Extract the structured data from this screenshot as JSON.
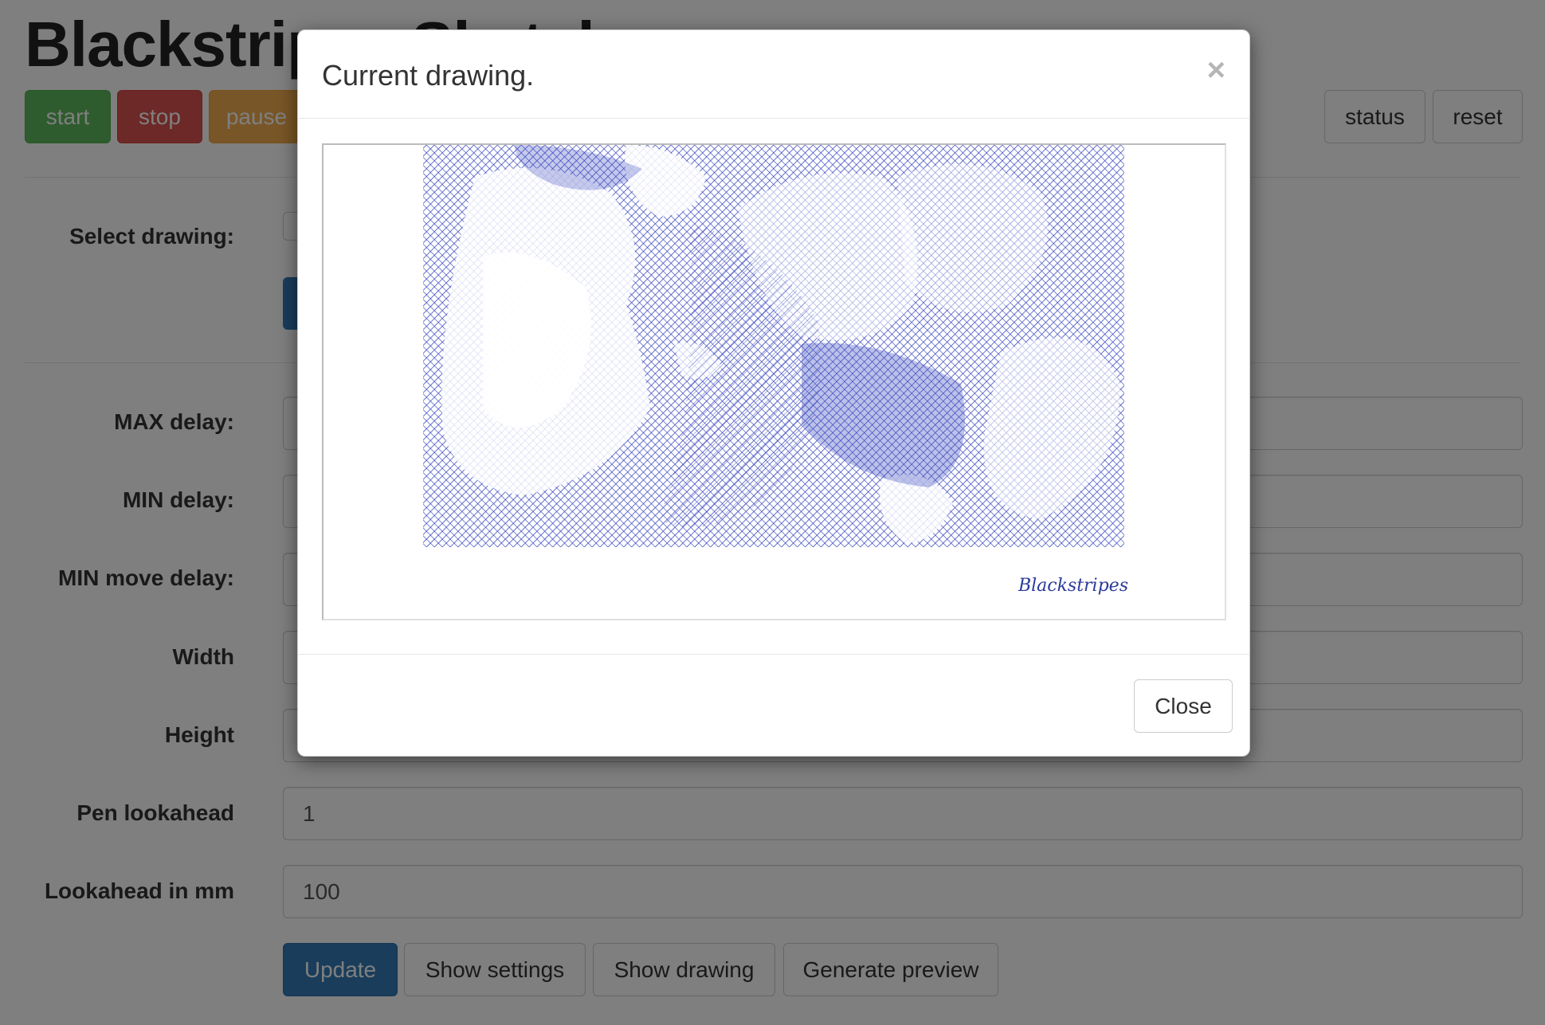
{
  "app": {
    "title": "Blackstripes Sketch"
  },
  "toolbar": {
    "start_label": "start",
    "stop_label": "stop",
    "pause_label": "pause",
    "status_label": "status",
    "reset_label": "reset"
  },
  "select_drawing": {
    "label": "Select drawing:"
  },
  "settings": {
    "fields": [
      {
        "label": "MAX delay:",
        "value": ""
      },
      {
        "label": "MIN delay:",
        "value": ""
      },
      {
        "label": "MIN move delay:",
        "value": ""
      },
      {
        "label": "Width",
        "value": ""
      },
      {
        "label": "Height",
        "value": ""
      },
      {
        "label": "Pen lookahead",
        "value": "1"
      },
      {
        "label": "Lookahead in mm",
        "value": "100"
      }
    ]
  },
  "actions": {
    "update_label": "Update",
    "show_settings_label": "Show settings",
    "show_drawing_label": "Show drawing",
    "generate_preview_label": "Generate preview"
  },
  "modal": {
    "title": "Current drawing.",
    "close_x": "×",
    "close_label": "Close",
    "signature": "Blackstripes"
  },
  "colors": {
    "ink": "#3f4dbf",
    "success": "#5cb85c",
    "danger": "#d9534f",
    "warning": "#f0ad4e",
    "primary": "#337ab7"
  }
}
